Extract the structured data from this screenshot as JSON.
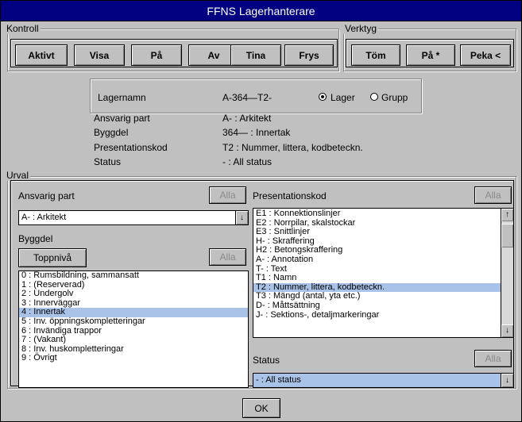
{
  "window": {
    "title": "FFNS Lagerhanterare"
  },
  "kontroll": {
    "label": "Kontroll",
    "buttons": [
      "Aktivt",
      "Visa",
      "På",
      "Av",
      "Tina",
      "Frys"
    ]
  },
  "verktyg": {
    "label": "Verktyg",
    "buttons": [
      "Töm",
      "På *",
      "Peka <"
    ]
  },
  "lager": {
    "name_label": "Lagernamn",
    "name_value": "A-364—T2-",
    "radio_lager": "Lager",
    "radio_grupp": "Grupp",
    "rows": [
      {
        "label": "Ansvarig part",
        "value": "A- : Arkitekt"
      },
      {
        "label": "Byggdel",
        "value": "364— : Innertak"
      },
      {
        "label": "Presentationskod",
        "value": "T2 :   Nummer, littera, kodbeteckn."
      },
      {
        "label": "Status",
        "value": "- : All status"
      }
    ]
  },
  "urval": {
    "label": "Urval",
    "ansvarig_label": "Ansvarig part",
    "alla": "Alla",
    "ansvarig_value": "A- : Arkitekt",
    "byggdel_label": "Byggdel",
    "toppniva": "Toppnivå",
    "byggdel_items": [
      "0 : Rumsbildning, sammansatt",
      "1 : (Reserverad)",
      "2 : Undergolv",
      "3 : Innerväggar",
      "4 : Innertak",
      "5 : Inv. öppningskompletteringar",
      "6 : Invändiga trappor",
      "7 : (Vakant)",
      "8 : Inv. huskompletteringar",
      "9 : Övrigt"
    ],
    "byggdel_selected": 4,
    "presentation_label": "Presentationskod",
    "presentation_items": [
      "E1 :   Konnektionslinjer",
      "E2 :   Norrpilar, skalstockar",
      "E3 :   Snittlinjer",
      "H- :  Skraffering",
      "H2 :   Betongskraffering",
      "A- :  Annotation",
      "T- :   Text",
      "T1 :      Namn",
      "T2 :      Nummer, littera, kodbeteckn.",
      "T3 :      Mängd (antal, yta etc.)",
      "D- :   Måttsättning",
      "J- :   Sektions-, detaljmarkeringar"
    ],
    "presentation_selected": 8,
    "status_label": "Status",
    "status_value": "- : All status"
  },
  "footer": {
    "ok": "OK"
  }
}
